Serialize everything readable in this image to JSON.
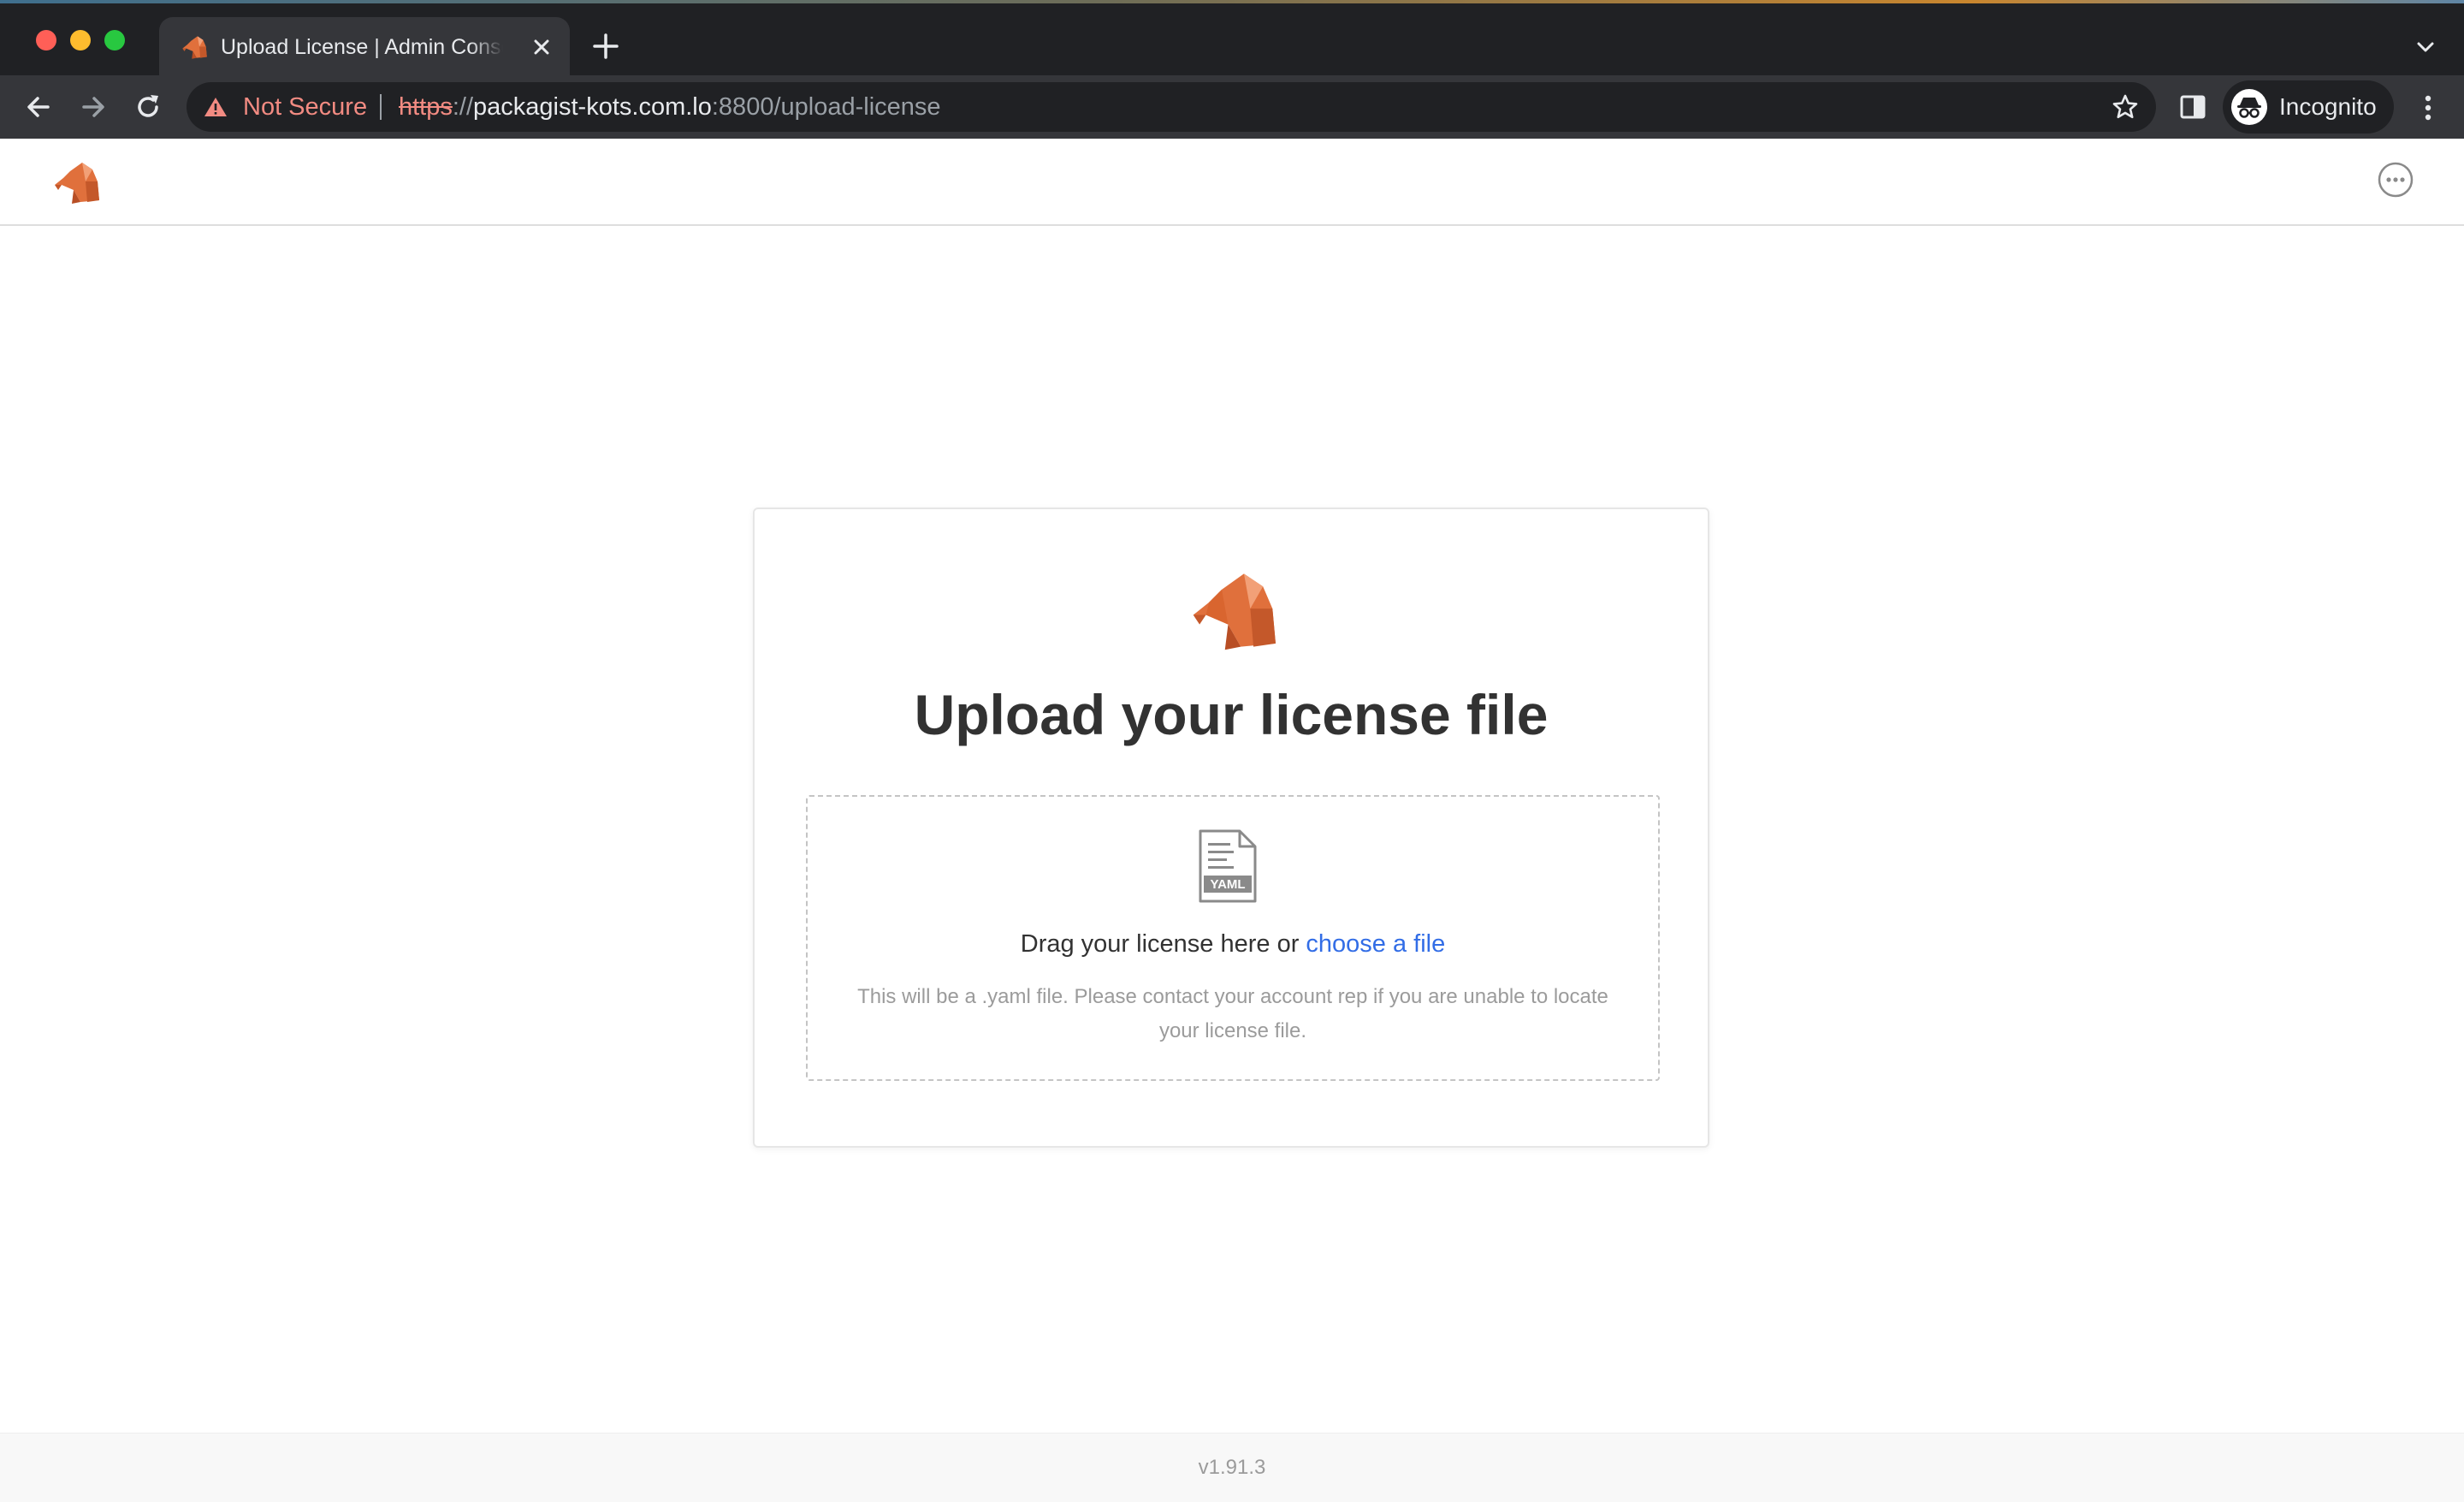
{
  "browser": {
    "tab": {
      "title": "Upload License | Admin Console",
      "favicon": "elephant-icon"
    },
    "address_bar": {
      "security_label": "Not Secure",
      "url_scheme": "https",
      "url_separator": "://",
      "url_host": "packagist-kots.com.lo",
      "url_path": ":8800/upload-license"
    },
    "profile": {
      "label": "Incognito",
      "icon": "incognito-icon"
    }
  },
  "header": {
    "logo": "elephant-logo",
    "menu_icon": "more-icon"
  },
  "upload": {
    "logo": "elephant-logo",
    "title": "Upload your license file",
    "file_icon": "yaml-file-icon",
    "file_icon_badge": "YAML",
    "drop_text": "Drag your license here or ",
    "choose_link": "choose a file",
    "help_text": "This will be a .yaml file. Please contact your account rep if you are unable to locate your license file."
  },
  "footer": {
    "version": "v1.91.3"
  },
  "colors": {
    "brand_orange": "#e0703c",
    "link_blue": "#326de6",
    "title_text": "#323232",
    "muted_text": "#9b9b9b",
    "chrome_dark": "#202124",
    "chrome_toolbar": "#35363a",
    "warning_red": "#f28b82"
  }
}
